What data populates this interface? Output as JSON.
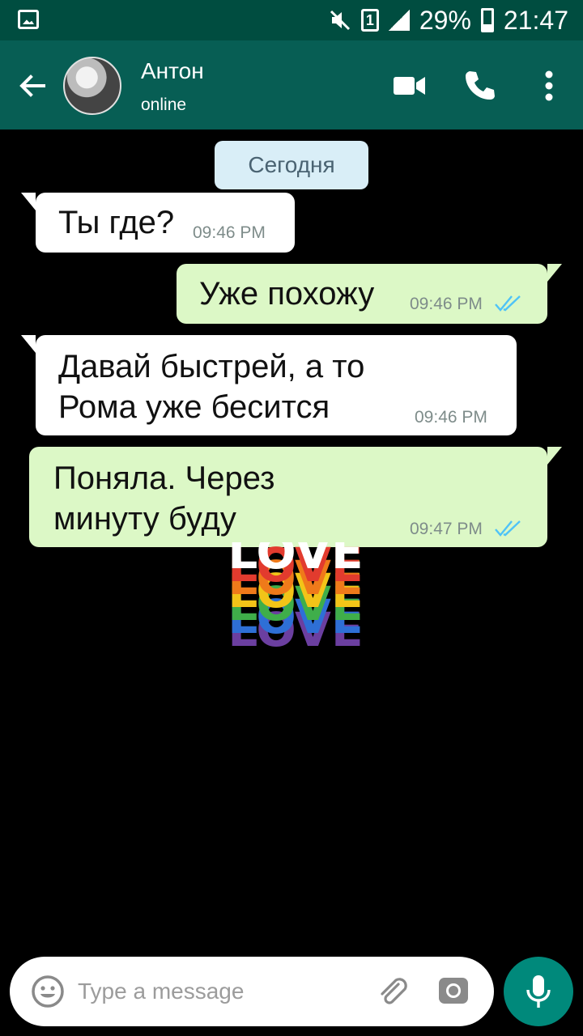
{
  "status_bar": {
    "battery": "29%",
    "time": "21:47",
    "sim_slot": "1",
    "icons": [
      "gallery-icon",
      "mute-icon",
      "sim-icon",
      "signal-icon",
      "battery-icon"
    ]
  },
  "header": {
    "contact_name": "Антон",
    "contact_status": "online",
    "icons": [
      "back-arrow-icon",
      "video-call-icon",
      "phone-icon",
      "more-vert-icon"
    ]
  },
  "chat": {
    "date_separator": "Сегодня",
    "messages": [
      {
        "direction": "incoming",
        "lines": [
          "Ты где?"
        ],
        "time": "09:46 PM"
      },
      {
        "direction": "outgoing",
        "lines": [
          "Уже похожу"
        ],
        "time": "09:46 PM",
        "read": true
      },
      {
        "direction": "incoming",
        "lines": [
          "Давай быстрей, а то",
          "Рома уже бесится"
        ],
        "time": "09:46 PM"
      },
      {
        "direction": "outgoing",
        "lines": [
          "Поняла. Через",
          "минуту буду"
        ],
        "time": "09:47 PM",
        "read": true
      }
    ],
    "wallpaper_text": "LOVE"
  },
  "input_bar": {
    "placeholder": "Type a message",
    "icons": [
      "emoji-icon",
      "attach-icon",
      "camera-icon",
      "mic-icon"
    ]
  },
  "colors": {
    "header": "#075e54",
    "status_bar": "#004d40",
    "incoming_bubble": "#ffffff",
    "outgoing_bubble": "#dcf8c6",
    "date_chip": "#d9eef7",
    "read_ticks": "#4fc3f7",
    "mic_button": "#00897b"
  }
}
